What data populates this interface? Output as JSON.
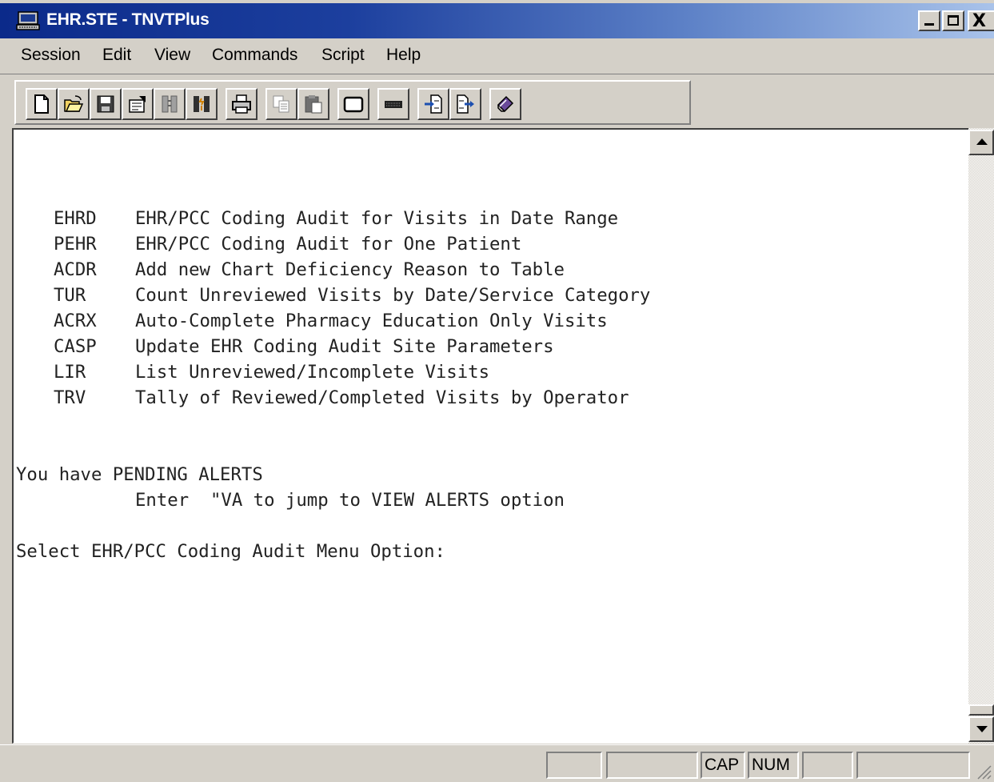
{
  "window": {
    "title": "EHR.STE - TNVTPlus",
    "close_glyph": "X"
  },
  "menu": [
    {
      "label": "Session"
    },
    {
      "label": "Edit"
    },
    {
      "label": "View"
    },
    {
      "label": "Commands"
    },
    {
      "label": "Script"
    },
    {
      "label": "Help"
    }
  ],
  "toolbar": [
    {
      "icon": "new-document-icon"
    },
    {
      "icon": "open-folder-icon"
    },
    {
      "icon": "save-icon"
    },
    {
      "icon": "properties-icon"
    },
    {
      "icon": "connect-icon"
    },
    {
      "icon": "disconnect-icon"
    },
    {
      "icon": "print-icon"
    },
    {
      "icon": "copy-icon"
    },
    {
      "icon": "paste-icon"
    },
    {
      "icon": "blank-screen-icon"
    },
    {
      "icon": "keyboard-icon"
    },
    {
      "icon": "receive-file-icon"
    },
    {
      "icon": "send-file-icon"
    },
    {
      "icon": "script-icon"
    }
  ],
  "terminal": {
    "menu_options": [
      {
        "code": "EHRD",
        "description": "EHR/PCC Coding Audit for Visits in Date Range"
      },
      {
        "code": "PEHR",
        "description": "EHR/PCC Coding Audit for One Patient"
      },
      {
        "code": "ACDR",
        "description": "Add new Chart Deficiency Reason to Table"
      },
      {
        "code": "TUR",
        "description": "Count Unreviewed Visits by Date/Service Category"
      },
      {
        "code": "ACRX",
        "description": "Auto-Complete Pharmacy Education Only Visits"
      },
      {
        "code": "CASP",
        "description": "Update EHR Coding Audit Site Parameters"
      },
      {
        "code": "LIR",
        "description": "List Unreviewed/Incomplete Visits"
      },
      {
        "code": "TRV",
        "description": "Tally of Reviewed/Completed Visits by Operator"
      }
    ],
    "alert_line": "You have PENDING ALERTS",
    "alert_instruction": "Enter  \"VA to jump to VIEW ALERTS option",
    "prompt": "Select EHR/PCC Coding Audit Menu Option:"
  },
  "statusbar": {
    "panes": [
      "",
      "",
      "CAP",
      "NUM",
      "",
      ""
    ]
  }
}
